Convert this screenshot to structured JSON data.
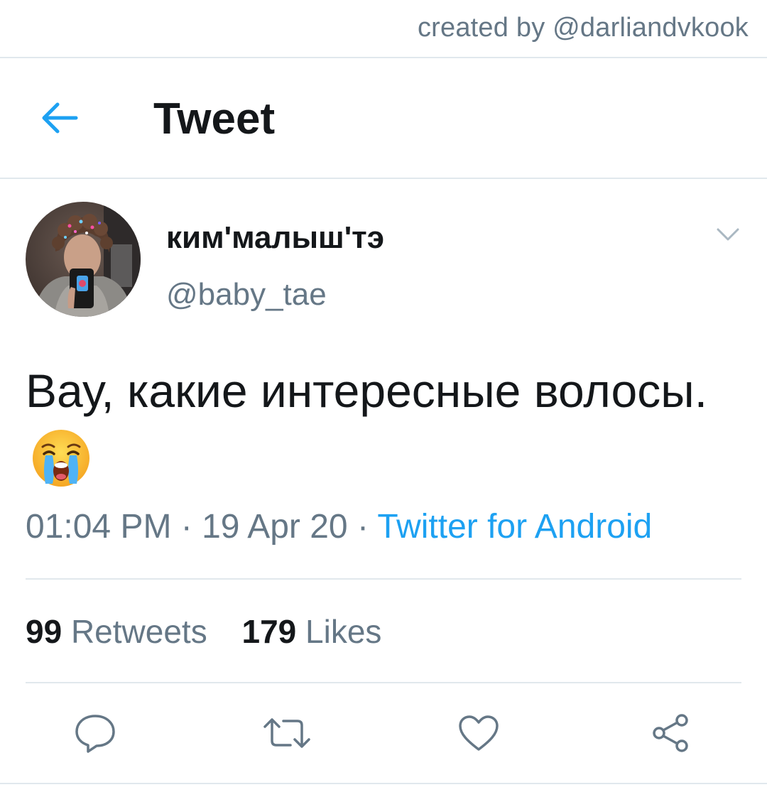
{
  "credit": {
    "text": "created by @darliandvkook"
  },
  "header": {
    "back_icon": "arrow-left-icon",
    "title": "Tweet"
  },
  "tweet": {
    "author": {
      "display_name": "ким'малыш'тэ",
      "handle": "@baby_tae"
    },
    "caret_icon": "chevron-down-icon",
    "text": "Вау, какие интересные волосы.",
    "emoji": "loudly-crying-face",
    "time": "01:04 PM",
    "separator": " · ",
    "date": "19 Apr 20",
    "source": "Twitter for Android",
    "stats": {
      "retweets_count": "99",
      "retweets_label": "Retweets",
      "likes_count": "179",
      "likes_label": "Likes"
    },
    "actions": [
      {
        "icon": "reply-icon"
      },
      {
        "icon": "retweet-icon"
      },
      {
        "icon": "like-heart-icon"
      },
      {
        "icon": "share-icon"
      }
    ]
  },
  "colors": {
    "accent": "#1da1f2",
    "text_primary": "#14171a",
    "text_secondary": "#657786",
    "divider": "#e1e8ed"
  }
}
